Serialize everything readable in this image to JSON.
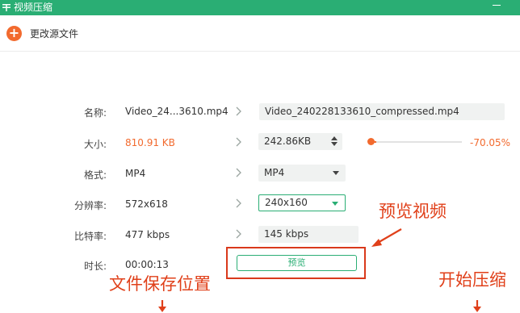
{
  "window": {
    "title": "视频压缩"
  },
  "toolbar": {
    "change_source_label": "更改源文件"
  },
  "labels": {
    "name": "名称:",
    "size": "大小:",
    "format": "格式:",
    "resolution": "分辨率:",
    "bitrate": "比特率:",
    "duration": "时长:"
  },
  "source": {
    "name": "Video_24...3610.mp4",
    "size": "810.91 KB",
    "format": "MP4",
    "resolution": "572x618",
    "bitrate": "477 kbps",
    "duration": "00:00:13"
  },
  "output": {
    "name": "Video_240228133610_compressed.mp4",
    "size": "242.86KB",
    "format": "MP4",
    "resolution": "240x160",
    "bitrate": "145 kbps",
    "compression_ratio": "-70.05%",
    "compression_level": 0.05
  },
  "preview_button": "预览",
  "annotations": {
    "preview_video": "预览视频",
    "save_location": "文件保存位置",
    "start_compress": "开始压缩"
  },
  "colors": {
    "brand_green": "#2aae74",
    "accent_orange": "#f26a2e",
    "annotation_red": "#e0401a"
  }
}
